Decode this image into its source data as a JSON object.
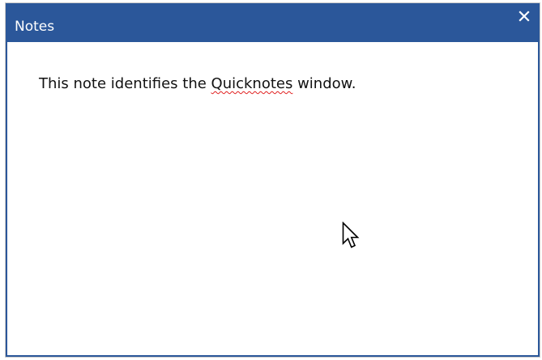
{
  "window": {
    "title": "Notes",
    "accent_color": "#2b579a",
    "close_icon": "close-icon"
  },
  "note": {
    "text_before": "This note identifies the ",
    "misspelled_word": "Quicknotes",
    "text_after": " window."
  },
  "pointer": {
    "icon": "mouse-pointer-icon"
  }
}
